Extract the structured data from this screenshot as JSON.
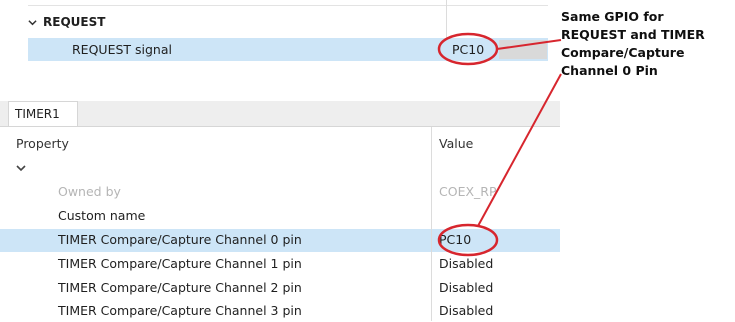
{
  "request_section": {
    "header": "REQUEST",
    "row": {
      "label": "REQUEST signal",
      "value": "PC10"
    }
  },
  "annotation": {
    "lines": [
      "Same GPIO for",
      "REQUEST and TIMER",
      "Compare/Capture",
      "Channel 0 Pin"
    ],
    "color": "#d7262e"
  },
  "timer_panel": {
    "tab_label": "TIMER1",
    "columns": {
      "property": "Property",
      "value": "Value"
    },
    "rows": [
      {
        "label": "Owned by",
        "value": "COEX_RP",
        "disabled": true
      },
      {
        "label": "Custom name",
        "value": ""
      },
      {
        "label": "TIMER Compare/Capture Channel 0 pin",
        "value": "PC10",
        "selected": true
      },
      {
        "label": "TIMER Compare/Capture Channel 1 pin",
        "value": "Disabled"
      },
      {
        "label": "TIMER Compare/Capture Channel 2 pin",
        "value": "Disabled"
      },
      {
        "label": "TIMER Compare/Capture Channel 3 pin",
        "value": "Disabled"
      }
    ]
  },
  "icons": {
    "section_expand": "chevron-down-icon",
    "group_expand": "chevron-down-icon"
  },
  "colors": {
    "selection": "#cde5f7",
    "highlight_ring": "#d7262e"
  }
}
